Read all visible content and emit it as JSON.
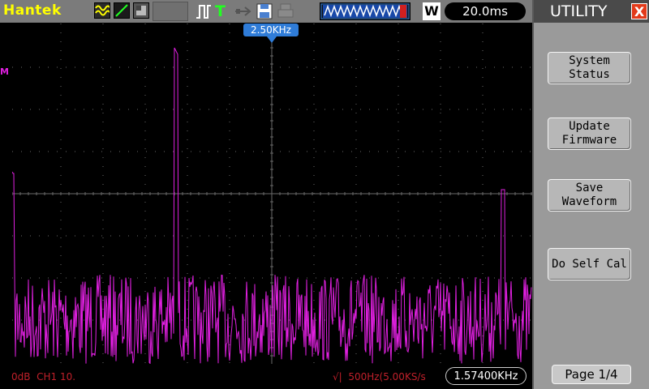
{
  "header": {
    "brand": "Hantek",
    "timebase": "20.0ms",
    "acquire_mode": "W",
    "icons": [
      "waveform-mode-icon",
      "ramp-icon",
      "display-icon",
      "trigger-edge-icon",
      "trigger-T-icon",
      "usb-icon",
      "save-disk-icon",
      "printer-icon",
      "memory-waveform-icon"
    ]
  },
  "screen": {
    "trigger_position": "2.50KHz",
    "math_marker": "M",
    "trace_color": "#e020e0",
    "grid_color": "#6a6a6a"
  },
  "status": {
    "channel_scale": "0dB  CH1 10.",
    "sample_info": "√|  500Hz(5.00KS/s",
    "cursor_freq": "1.57400KHz"
  },
  "menu": {
    "title": "UTILITY",
    "close_label": "X",
    "items": [
      {
        "label": "System\nStatus"
      },
      {
        "label": "Update\nFirmware"
      },
      {
        "label": "Save\nWaveform"
      },
      {
        "label": "Do Self Cal"
      }
    ],
    "page": "Page 1/4"
  }
}
